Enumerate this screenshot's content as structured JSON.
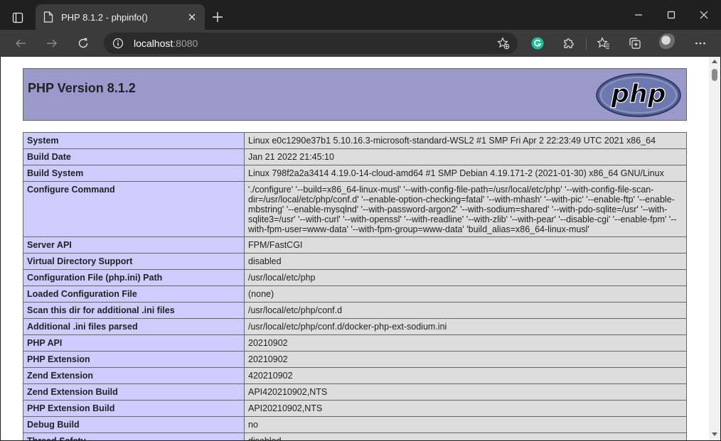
{
  "tab": {
    "title": "PHP 8.1.2 - phpinfo()"
  },
  "address": {
    "host": "localhost",
    "port": ":8080"
  },
  "page": {
    "heading": "PHP Version 8.1.2",
    "logo_text": "php",
    "rows": [
      {
        "key": "System",
        "value": "Linux e0c1290e37b1 5.10.16.3-microsoft-standard-WSL2 #1 SMP Fri Apr 2 22:23:49 UTC 2021 x86_64"
      },
      {
        "key": "Build Date",
        "value": "Jan 21 2022 21:45:10"
      },
      {
        "key": "Build System",
        "value": "Linux 798f2a2a3414 4.19.0-14-cloud-amd64 #1 SMP Debian 4.19.171-2 (2021-01-30) x86_64 GNU/Linux"
      },
      {
        "key": "Configure Command",
        "value": "'./configure' '--build=x86_64-linux-musl' '--with-config-file-path=/usr/local/etc/php' '--with-config-file-scan-dir=/usr/local/etc/php/conf.d' '--enable-option-checking=fatal' '--with-mhash' '--with-pic' '--enable-ftp' '--enable-mbstring' '--enable-mysqlnd' '--with-password-argon2' '--with-sodium=shared' '--with-pdo-sqlite=/usr' '--with-sqlite3=/usr' '--with-curl' '--with-openssl' '--with-readline' '--with-zlib' '--with-pear' '--disable-cgi' '--enable-fpm' '--with-fpm-user=www-data' '--with-fpm-group=www-data' 'build_alias=x86_64-linux-musl'"
      },
      {
        "key": "Server API",
        "value": "FPM/FastCGI"
      },
      {
        "key": "Virtual Directory Support",
        "value": "disabled"
      },
      {
        "key": "Configuration File (php.ini) Path",
        "value": "/usr/local/etc/php"
      },
      {
        "key": "Loaded Configuration File",
        "value": "(none)"
      },
      {
        "key": "Scan this dir for additional .ini files",
        "value": "/usr/local/etc/php/conf.d"
      },
      {
        "key": "Additional .ini files parsed",
        "value": "/usr/local/etc/php/conf.d/docker-php-ext-sodium.ini"
      },
      {
        "key": "PHP API",
        "value": "20210902"
      },
      {
        "key": "PHP Extension",
        "value": "20210902"
      },
      {
        "key": "Zend Extension",
        "value": "420210902"
      },
      {
        "key": "Zend Extension Build",
        "value": "API420210902,NTS"
      },
      {
        "key": "PHP Extension Build",
        "value": "API20210902,NTS"
      },
      {
        "key": "Debug Build",
        "value": "no"
      },
      {
        "key": "Thread Safety",
        "value": "disabled"
      }
    ]
  },
  "colors": {
    "header_bg": "#9999cc",
    "key_bg": "#ccccff",
    "value_bg": "#dddddd",
    "chrome_dark": "#202020",
    "toolbar": "#3b3b3b",
    "grammarly": "#15c39a"
  }
}
